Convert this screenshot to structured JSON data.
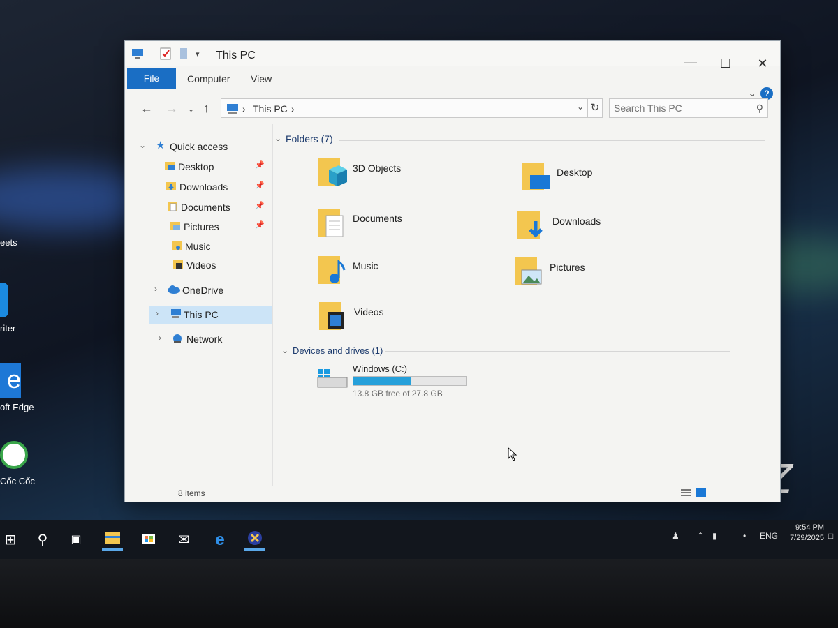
{
  "window": {
    "title": "This PC",
    "ribbon_tabs": [
      {
        "label": "File",
        "active": true
      },
      {
        "label": "Computer",
        "active": false
      },
      {
        "label": "View",
        "active": false
      }
    ],
    "help": "?"
  },
  "addressbar": {
    "crumbs": [
      "This PC"
    ],
    "search_placeholder": "Search This PC"
  },
  "navpane": {
    "items": [
      {
        "label": "Quick access",
        "icon": "star-icon",
        "expanded": true
      },
      {
        "label": "Desktop",
        "icon": "folder-desktop-icon",
        "pinned": true
      },
      {
        "label": "Downloads",
        "icon": "folder-downloads-icon",
        "pinned": true
      },
      {
        "label": "Documents",
        "icon": "folder-documents-icon",
        "pinned": true
      },
      {
        "label": "Pictures",
        "icon": "folder-pictures-icon",
        "pinned": true
      },
      {
        "label": "Music",
        "icon": "folder-music-icon",
        "pinned": false
      },
      {
        "label": "Videos",
        "icon": "folder-videos-icon",
        "pinned": false
      },
      {
        "label": "OneDrive",
        "icon": "cloud-icon",
        "expanded": false
      },
      {
        "label": "This PC",
        "icon": "computer-icon",
        "expanded": false,
        "selected": true
      },
      {
        "label": "Network",
        "icon": "network-icon",
        "expanded": false
      }
    ]
  },
  "content": {
    "folders_header": "Folders (7)",
    "folders": [
      {
        "label": "3D Objects",
        "icon": "folder-3d-objects-icon"
      },
      {
        "label": "Desktop",
        "icon": "folder-desktop-icon"
      },
      {
        "label": "Documents",
        "icon": "folder-documents-icon"
      },
      {
        "label": "Downloads",
        "icon": "folder-downloads-icon"
      },
      {
        "label": "Music",
        "icon": "folder-music-icon"
      },
      {
        "label": "Pictures",
        "icon": "folder-pictures-icon"
      },
      {
        "label": "Videos",
        "icon": "folder-videos-icon"
      }
    ],
    "drives_header": "Devices and drives (1)",
    "drive": {
      "name": "Windows (C:)",
      "free_text": "13.8 GB free of 27.8 GB",
      "used_fraction": 0.504
    }
  },
  "statusbar": {
    "item_count": "8 items"
  },
  "desktop": {
    "icon_labels": [
      "eets",
      "riter",
      "oft Edge",
      "Cốc Cốc"
    ],
    "watermark": "WiZ"
  },
  "taskbar": {
    "language": "ENG",
    "time": "9:54 PM",
    "date": "7/29/2025"
  },
  "colors": {
    "accent": "#1a6ec4",
    "selection": "#cce4f7",
    "drive_fill": "#26a0da",
    "folder_yellow": "#f3c64f"
  }
}
